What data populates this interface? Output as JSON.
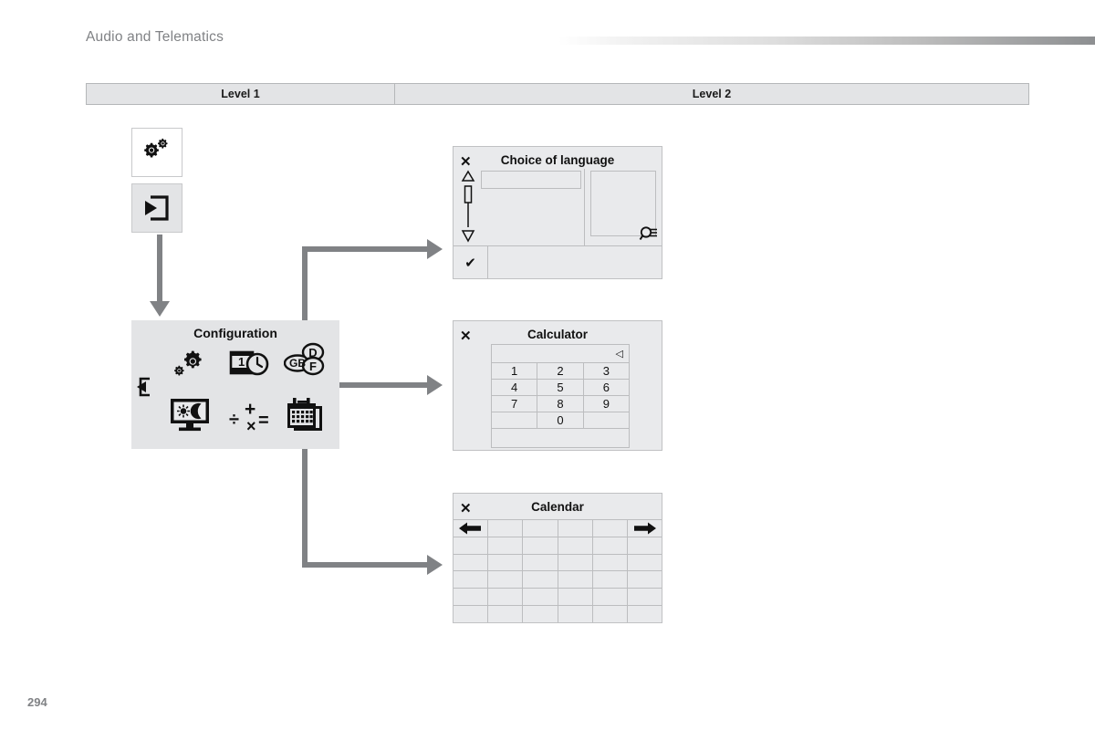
{
  "header": {
    "title": "Audio and Telematics"
  },
  "level_table": {
    "columns": [
      {
        "label": "Level 1"
      },
      {
        "label": "Level 2"
      }
    ]
  },
  "level1_icons": [
    {
      "name": "settings-gears-icon",
      "label": ""
    },
    {
      "name": "enter-menu-icon",
      "label": ""
    }
  ],
  "config_panel": {
    "title": "Configuration",
    "back_icon": "back-arrow-icon",
    "icons": [
      {
        "name": "settings-gears-icon",
        "label": ""
      },
      {
        "name": "date-time-icon",
        "label": ""
      },
      {
        "name": "language-icon",
        "labels": [
          "GB",
          "D",
          "F"
        ]
      },
      {
        "name": "display-brightness-icon",
        "label": ""
      },
      {
        "name": "calculator-icon",
        "symbols": [
          "÷",
          "+",
          "×",
          "="
        ]
      },
      {
        "name": "calendar-icon",
        "label": ""
      }
    ]
  },
  "language_panel": {
    "title": "Choice of language",
    "close_label": "✕",
    "confirm_label": "✔",
    "scrollbar": {
      "up": "▲",
      "down": "▼"
    },
    "search_icon": "search-list-icon",
    "field_value": "",
    "list_value": ""
  },
  "calculator_panel": {
    "title": "Calculator",
    "close_label": "✕",
    "display_value": "",
    "backspace_label": "◁",
    "keys": [
      [
        "1",
        "2",
        "3"
      ],
      [
        "4",
        "5",
        "6"
      ],
      [
        "7",
        "8",
        "9"
      ],
      [
        "",
        "0",
        ""
      ]
    ],
    "footer_value": ""
  },
  "calendar_panel": {
    "title": "Calendar",
    "close_label": "✕",
    "prev_label": "←",
    "next_label": "→",
    "rows": 6,
    "columns": 6,
    "cells": [
      [
        "prev",
        "",
        "",
        "",
        "",
        "next"
      ],
      [
        "",
        "",
        "",
        "",
        "",
        ""
      ],
      [
        "",
        "",
        "",
        "",
        "",
        ""
      ],
      [
        "",
        "",
        "",
        "",
        "",
        ""
      ],
      [
        "",
        "",
        "",
        "",
        "",
        ""
      ],
      [
        "",
        "",
        "",
        "",
        "",
        ""
      ]
    ]
  },
  "footer": {
    "page_number": "294"
  },
  "colors": {
    "connector": "#808285",
    "panel_bg": "#e9eaec",
    "panel_border": "#c0c1c3",
    "header_text": "#808285",
    "table_bg": "#e3e4e6"
  }
}
